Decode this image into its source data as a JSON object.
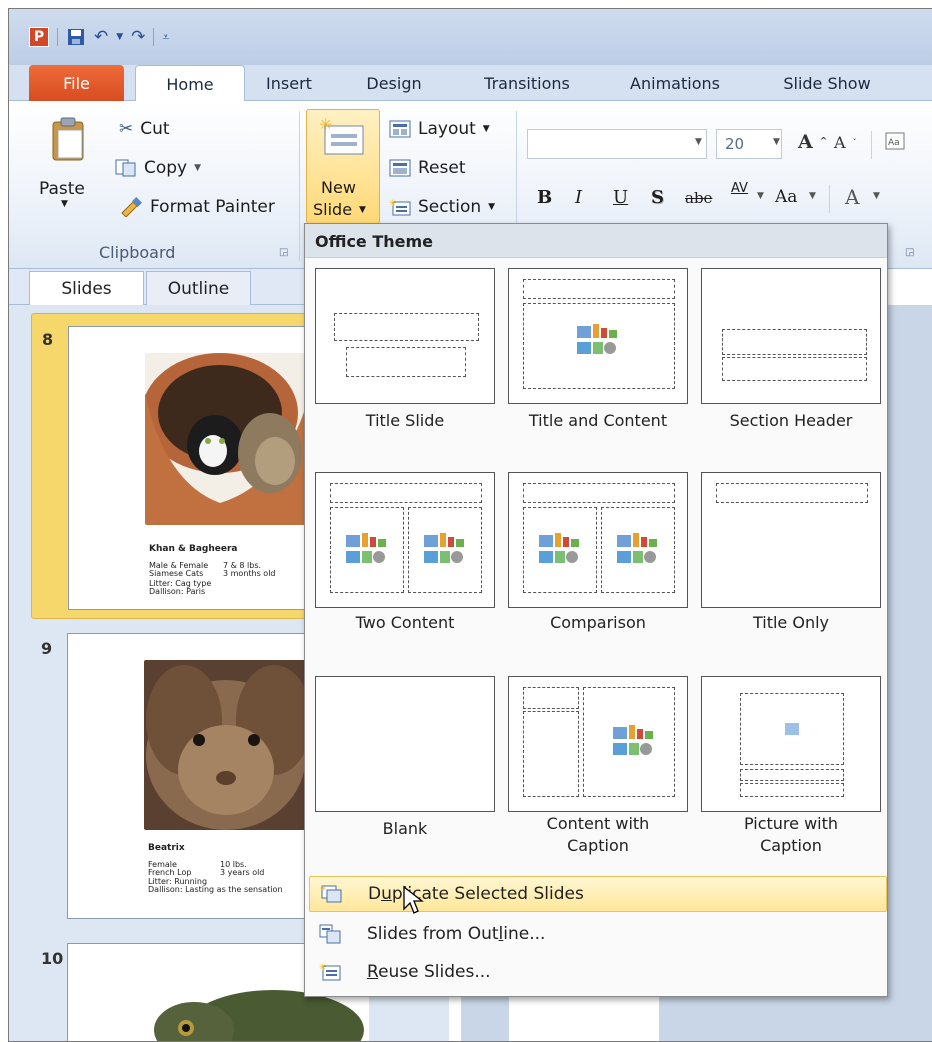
{
  "app": {
    "logo_letter": "P",
    "qat_icons": [
      "save-icon",
      "undo-icon",
      "redo-icon",
      "customize-icon"
    ]
  },
  "tabs": [
    {
      "label": "File"
    },
    {
      "label": "Home"
    },
    {
      "label": "Insert"
    },
    {
      "label": "Design"
    },
    {
      "label": "Transitions"
    },
    {
      "label": "Animations"
    },
    {
      "label": "Slide Show"
    }
  ],
  "clipboard": {
    "paste": "Paste",
    "cut": "Cut",
    "copy": "Copy",
    "format_painter": "Format Painter",
    "group_label": "Clipboard"
  },
  "slides_group": {
    "new_slide_line1": "New",
    "new_slide_line2": "Slide",
    "layout": "Layout",
    "reset": "Reset",
    "section": "Section"
  },
  "font_group": {
    "font_size": "20",
    "bold": "B",
    "italic": "I",
    "underline": "U",
    "shadow": "S",
    "strike": "abe",
    "spacing": "AV",
    "case": "Aa",
    "color": "A"
  },
  "panel_tabs": {
    "slides": "Slides",
    "outline": "Outline"
  },
  "slides": [
    {
      "number": "8",
      "title": "Khan & Bagheera",
      "lines_left": [
        "Male & Female",
        "Siamese Cats",
        "Litter: Cag type",
        "Dallison: Paris"
      ],
      "lines_right": [
        "7 & 8 lbs.",
        "3 months old"
      ]
    },
    {
      "number": "9",
      "title": "Beatrix",
      "lines_left": [
        "Female",
        "French Lop",
        "Litter: Running",
        "Dallison: Lasting as the sensation"
      ],
      "lines_right": [
        "10 lbs.",
        "3 years old"
      ]
    },
    {
      "number": "10"
    }
  ],
  "menu": {
    "header": "Office Theme",
    "layouts": [
      {
        "label": "Title Slide"
      },
      {
        "label": "Title and Content"
      },
      {
        "label": "Section Header"
      },
      {
        "label": "Two Content"
      },
      {
        "label": "Comparison"
      },
      {
        "label": "Title Only"
      },
      {
        "label": "Blank"
      },
      {
        "label_1": "Content with",
        "label_2": "Caption"
      },
      {
        "label_1": "Picture with",
        "label_2": "Caption"
      }
    ],
    "duplicate": {
      "pre": "D",
      "u": "u",
      "post": "plicate Selected Slides"
    },
    "from_outline": {
      "pre": "Slides from Out",
      "u": "l",
      "post": "ine..."
    },
    "reuse": {
      "pre": "",
      "u": "R",
      "post": "euse Slides..."
    }
  },
  "colors": {
    "file_tab": "#d74c20",
    "highlight": "#ffe79a",
    "selected_slide": "#f6d76b"
  }
}
